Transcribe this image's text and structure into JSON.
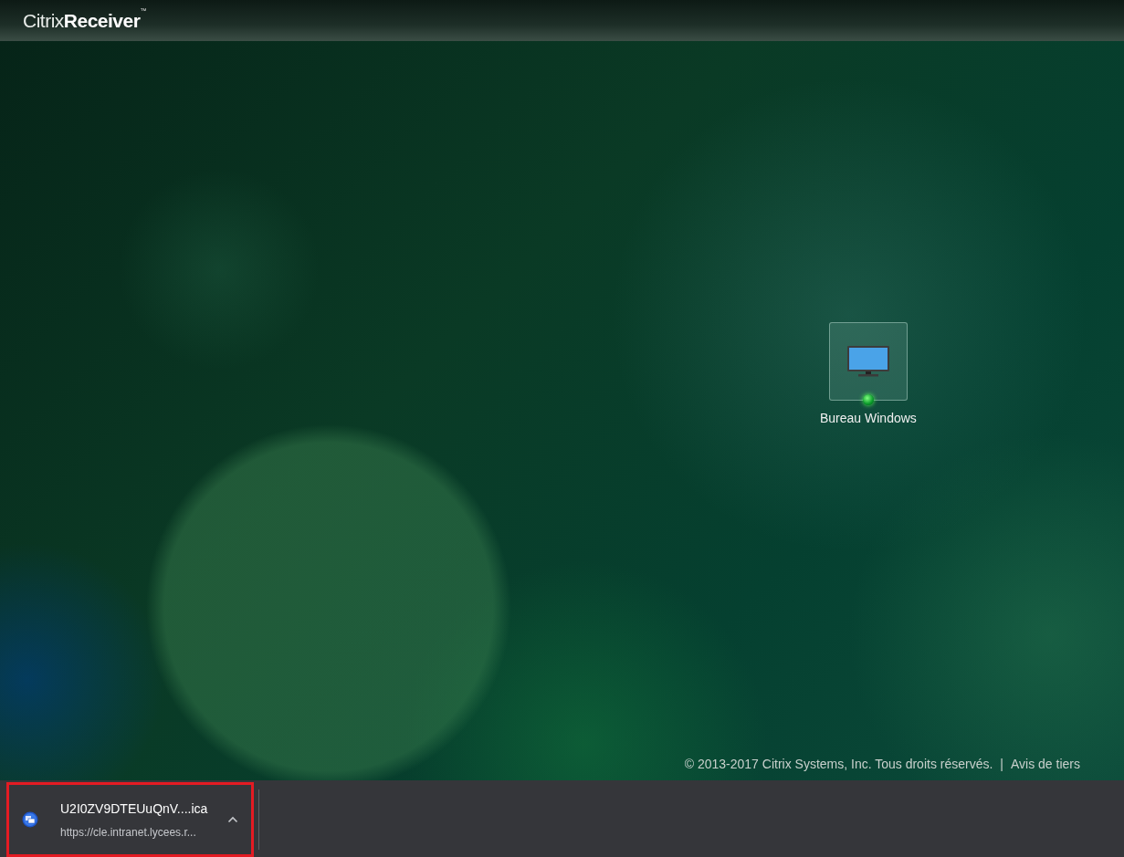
{
  "header": {
    "logo": {
      "brand": "Citrix",
      "product": "Receiver",
      "mark": "™"
    }
  },
  "desktops": [
    {
      "label": "Bureau Windows",
      "online": true
    }
  ],
  "footer": {
    "copyright": "© 2013-2017 Citrix Systems, Inc. Tous droits réservés.",
    "separator": "|",
    "link": "Avis de tiers"
  },
  "download_bar": {
    "items": [
      {
        "filename": "U2I0ZV9DTEUuQnV....ica",
        "url": "https://cle.intranet.lycees.r...",
        "highlighted": true
      }
    ]
  }
}
